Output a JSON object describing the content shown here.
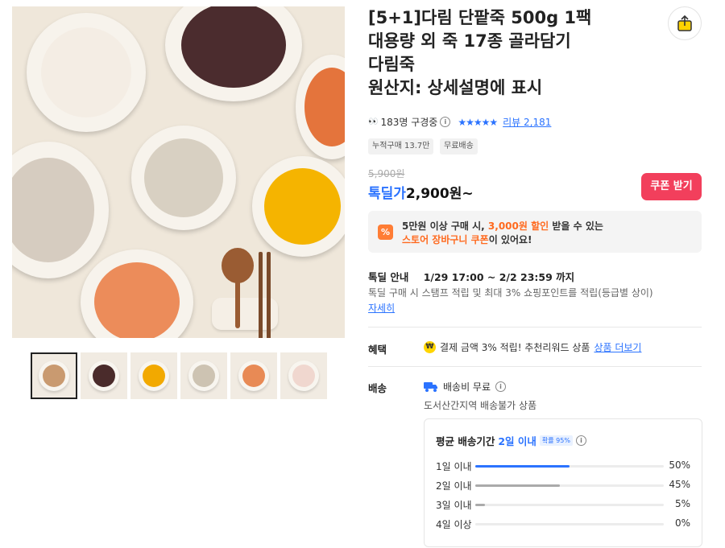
{
  "product": {
    "title": "[5+1]다림 단팥죽 500g 1팩\n대용량 외 죽 17종 골라담기\n다림죽\n원산지: 상세설명에 표시",
    "viewers": "183명 구경중",
    "viewer_icon": "eyes-icon",
    "rating_stars": "★★★★★",
    "review_link": "리뷰 2,181",
    "tags": [
      "누적구매 13.7만",
      "무료배송"
    ]
  },
  "thumbnails": [
    {
      "name": "assorted",
      "color": "#c99a70",
      "active": true
    },
    {
      "name": "red-bean",
      "color": "#4a2b2b",
      "active": false
    },
    {
      "name": "pumpkin",
      "color": "#f2a900",
      "active": false
    },
    {
      "name": "vegetable",
      "color": "#cdc3b2",
      "active": false
    },
    {
      "name": "seafood",
      "color": "#e88a55",
      "active": false
    },
    {
      "name": "crab",
      "color": "#f0d7cf",
      "active": false
    }
  ],
  "price": {
    "original": "5,900원",
    "deal_label": "톡딜가",
    "deal_price": "2,900원~",
    "coupon_button": "쿠폰 받기"
  },
  "promo": {
    "icon_text": "%",
    "line1_a": "5만원 이상 구매 시,",
    "line1_b": "3,000원 할인",
    "line1_c": "받을 수 있는",
    "line2_a": "스토어 장바구니 쿠폰",
    "line2_b": "이 있어요!"
  },
  "deal": {
    "label": "톡딜 안내",
    "period": "1/29 17:00 ~ 2/2 23:59 까지",
    "desc": "톡딜 구매 시 스탬프 적립 및 최대 3% 쇼핑포인트를 적립(등급별 상이)",
    "more": "자세히"
  },
  "benefit": {
    "label": "혜택",
    "icon": "₩",
    "text": "결제 금액 3% 적립! 추천리워드 상품",
    "link": "상품 더보기"
  },
  "shipping": {
    "label": "배송",
    "fee": "배송비 무료",
    "note": "도서산간지역 배송불가 상품",
    "avg_label": "평균 배송기간",
    "avg_value": "2일 이내",
    "prob": "확률 95%",
    "distribution": [
      {
        "label": "1일 이내",
        "percent": "50%",
        "value": 0.5,
        "color": "#2b73ff"
      },
      {
        "label": "2일 이내",
        "percent": "45%",
        "value": 0.45,
        "color": "#aaaaaa"
      },
      {
        "label": "3일 이내",
        "percent": "5%",
        "value": 0.05,
        "color": "#aaaaaa"
      },
      {
        "label": "4일 이상",
        "percent": "0%",
        "value": 0,
        "color": "#aaaaaa"
      }
    ]
  },
  "colors": {
    "accent": "#2b73ff",
    "coupon": "#f23f5c",
    "orange": "#ff6a1f"
  }
}
